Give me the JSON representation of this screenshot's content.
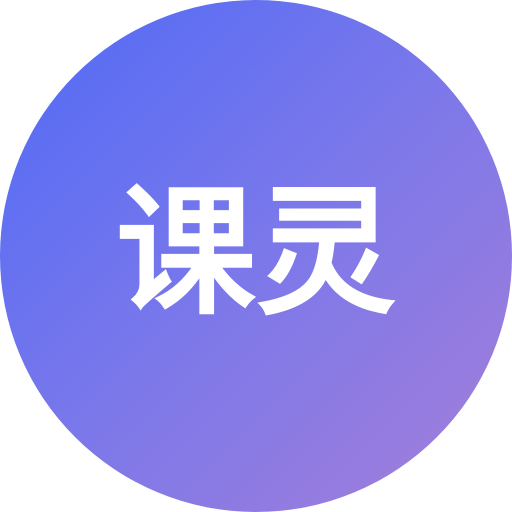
{
  "app_icon": {
    "label": "课灵",
    "colors": {
      "gradient_start": "#4f6af7",
      "gradient_mid": "#7b78ea",
      "gradient_end": "#a57ed9",
      "text": "#ffffff"
    }
  }
}
